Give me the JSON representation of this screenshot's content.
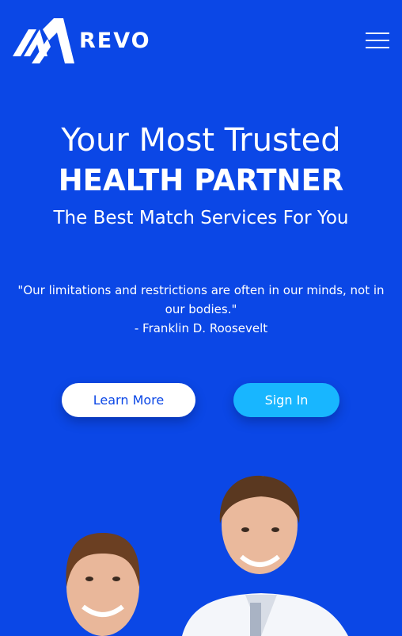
{
  "header": {
    "brand": "REVO",
    "logo_icon": "revo-logo-mark",
    "menu_icon": "hamburger-menu-icon"
  },
  "hero": {
    "line1": "Your Most Trusted",
    "line2": "HEALTH PARTNER",
    "subtitle": "The Best Match Services For You"
  },
  "quote": {
    "text": "\"Our limitations and restrictions are often in our minds, not in our bodies.\"",
    "author": "- Franklin D. Roosevelt"
  },
  "buttons": {
    "learn_more": "Learn More",
    "sign_in": "Sign In"
  },
  "colors": {
    "background": "#0b47e6",
    "accent": "#18b6ff",
    "text": "#ffffff"
  }
}
